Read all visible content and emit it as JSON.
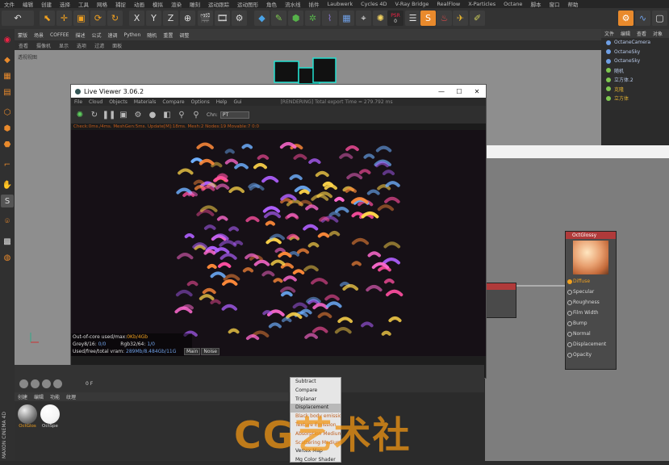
{
  "menubar": [
    "文件",
    "编辑",
    "创建",
    "选择",
    "工具",
    "网格",
    "捕捉",
    "动画",
    "模拟",
    "渲染",
    "雕刻",
    "运动跟踪",
    "运动图形",
    "角色",
    "流水线",
    "插件",
    "Laubwerk",
    "Cycles 4D",
    "V-Ray Bridge",
    "RealFlow",
    "X-Particles",
    "Octane",
    "脚本",
    "窗口",
    "帮助"
  ],
  "toolbar": {
    "psr_label": "PSR",
    "psr_value": "0"
  },
  "subbar": [
    "查看",
    "摄像机",
    "显示",
    "选项",
    "过滤",
    "面板",
    "Python",
    "编辑",
    "透视视图",
    "标签",
    "灯光",
    "材质",
    "预设",
    "替换",
    "合并",
    "断开连接",
    "加入父级",
    "对齐父级"
  ],
  "subbar_main": [
    "蒙版",
    "场景",
    "COFFEE",
    "描述",
    "公式",
    "速调",
    "Python",
    "随机",
    "重置",
    "调整"
  ],
  "viewport": {
    "label": "透视视图",
    "menu": [
      "查看",
      "摄像机",
      "显示",
      "选项",
      "过滤",
      "面板"
    ]
  },
  "rightpanel": {
    "tabs": [
      "文件",
      "编辑",
      "查看",
      "对象"
    ],
    "objects": [
      "OctaneCamera",
      "OctaneSky",
      "OctaneSky",
      "随机",
      "立方体.2",
      "克隆",
      "立方体"
    ]
  },
  "liveviewer": {
    "title": "Live Viewer 3.06.2",
    "menu": [
      "File",
      "Cloud",
      "Objects",
      "Materials",
      "Compare",
      "Options",
      "Help",
      "Gui"
    ],
    "status_top": "[RENDERING] Total export Time = 279.792 ms",
    "chn_label": "Chn:",
    "chn_value": "PT",
    "check_line": "Check:0ms./4ms. MeshGen:5ms. Update[M]:18ms. Mesh:2 Nodes:19 Movable:7 0:0",
    "footer": {
      "line1_label": "Out-of-core used/max:",
      "line1_value": "0Kb/4Gb",
      "line2_label": "Grey8/16: ",
      "line2_value": "0/0",
      "line2b_label": "Rgb32/64: ",
      "line2b_value": "1/0",
      "line3_label": "Used/free/total vram: ",
      "line3_value": "289Mb/8.484Gb/11G"
    },
    "tabs": [
      "Main",
      "Noise"
    ]
  },
  "node": {
    "title": "OctGlossy",
    "pins": [
      "Diffuse",
      "Specular",
      "Roughness",
      "Film Width",
      "Bump",
      "Normal",
      "Displacement",
      "Opacity"
    ]
  },
  "materials": {
    "tabs": [
      "创建",
      "编辑",
      "功能",
      "纹理"
    ],
    "items": [
      "OctGlos",
      "OctSpe"
    ]
  },
  "dropdown": [
    "Subtract",
    "Compare",
    "Triplanar",
    "Displacement",
    "Black body emission",
    "Texture Emission",
    "Absorption Medium",
    "Scattering Medium",
    "Vertex Map",
    "Mg Color Shader"
  ],
  "timeline": {
    "frame": "0 F"
  },
  "watermark": "CG艺术社",
  "colors": {
    "accent": "#f0a020",
    "node_header": "#b03a3a",
    "node_editor_bg": "#7d7d7d",
    "viewport_bg": "#8e8e8e"
  }
}
